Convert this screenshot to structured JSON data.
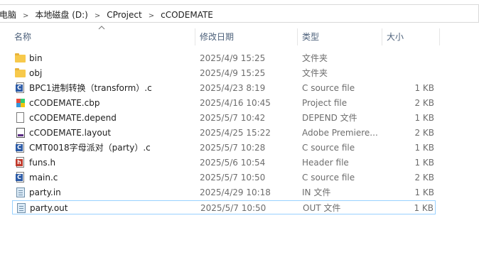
{
  "breadcrumb": [
    "电脑",
    "本地磁盘 (D:)",
    "CProject",
    "cCODEMATE"
  ],
  "columns": {
    "name": "名称",
    "date": "修改日期",
    "type": "类型",
    "size": "大小"
  },
  "files": [
    {
      "name": "bin",
      "date": "2025/4/9 15:25",
      "type": "文件夹",
      "size": "",
      "icon": "folder-icon"
    },
    {
      "name": "obj",
      "date": "2025/4/9 15:25",
      "type": "文件夹",
      "size": "",
      "icon": "folder-icon"
    },
    {
      "name": "BPC1进制转换（transform）.c",
      "date": "2025/4/23 8:19",
      "type": "C source file",
      "size": "1 KB",
      "icon": "c-source-icon"
    },
    {
      "name": "cCODEMATE.cbp",
      "date": "2025/4/16 10:45",
      "type": "Project file",
      "size": "2 KB",
      "icon": "codeblocks-project-icon"
    },
    {
      "name": "cCODEMATE.depend",
      "date": "2025/5/7 10:42",
      "type": "DEPEND 文件",
      "size": "1 KB",
      "icon": "blank-file-icon"
    },
    {
      "name": "cCODEMATE.layout",
      "date": "2025/4/25 15:22",
      "type": "Adobe Premiere...",
      "size": "2 KB",
      "icon": "layout-file-icon"
    },
    {
      "name": "CMT0018字母派对（party）.c",
      "date": "2025/5/7 10:28",
      "type": "C source file",
      "size": "1 KB",
      "icon": "c-source-icon"
    },
    {
      "name": "funs.h",
      "date": "2025/5/6 10:54",
      "type": "Header file",
      "size": "1 KB",
      "icon": "header-file-icon"
    },
    {
      "name": "main.c",
      "date": "2025/5/7 10:50",
      "type": "C source file",
      "size": "2 KB",
      "icon": "c-source-icon"
    },
    {
      "name": "party.in",
      "date": "2025/4/29 10:18",
      "type": "IN 文件",
      "size": "1 KB",
      "icon": "text-file-icon"
    },
    {
      "name": "party.out",
      "date": "2025/5/7 10:50",
      "type": "OUT 文件",
      "size": "1 KB",
      "icon": "text-file-icon",
      "selected": true
    }
  ]
}
